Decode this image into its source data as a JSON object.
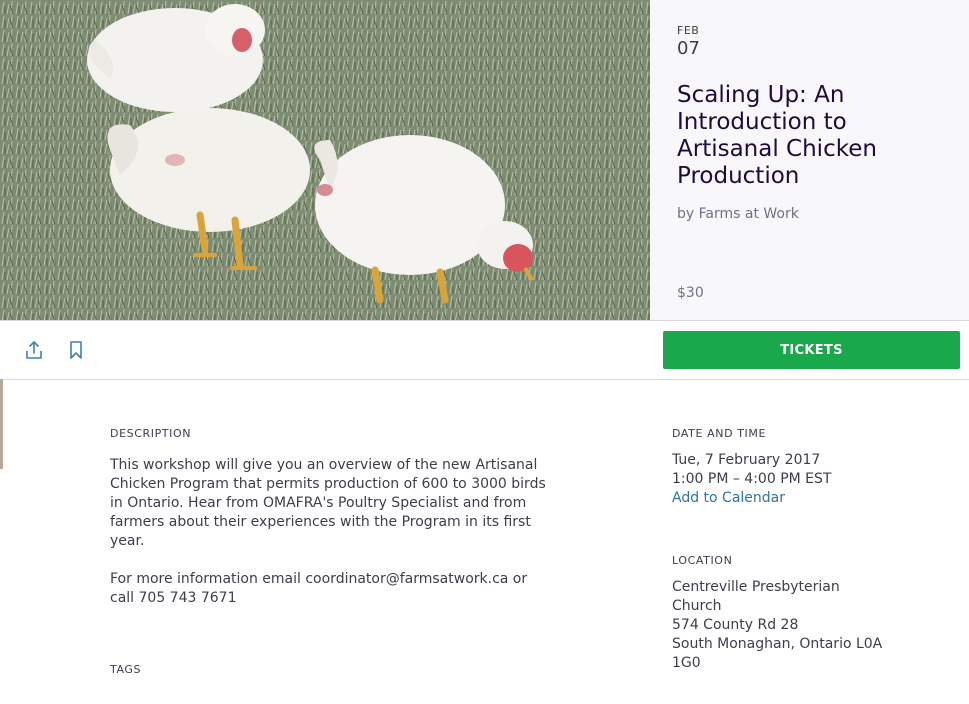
{
  "event": {
    "month": "FEB",
    "day": "07",
    "title": "Scaling Up: An Introduction to Artisanal Chicken Production",
    "organizer": "by Farms at Work",
    "price": "$30"
  },
  "actions": {
    "share_icon": "share-icon",
    "save_icon": "bookmark-icon",
    "tickets_label": "TICKETS"
  },
  "description": {
    "label": "DESCRIPTION",
    "paragraph": "This workshop will give you an overview of the new Artisanal Chicken Program that permits production of 600 to 3000 birds in Ontario. Hear from OMAFRA's Poultry Specialist and from farmers about their experiences with the Program in its first year.",
    "contact": "For more information email coordinator@farmsatwork.ca or call 705 743 7671"
  },
  "tags": {
    "label": "TAGS"
  },
  "datetime": {
    "label": "DATE AND TIME",
    "date": "Tue, 7 February 2017",
    "time": "1:00 PM – 4:00 PM EST",
    "calendar_link": "Add to Calendar"
  },
  "location": {
    "label": "LOCATION",
    "line1": "Centreville Presbyterian",
    "line2": "Church",
    "line3": "574 County Rd 28",
    "line4": "South Monaghan, Ontario L0A",
    "line5": "1G0"
  },
  "colors": {
    "tickets_green": "#19a84b",
    "link_blue": "#2f72a8",
    "title_dark": "#1e0a3c"
  }
}
